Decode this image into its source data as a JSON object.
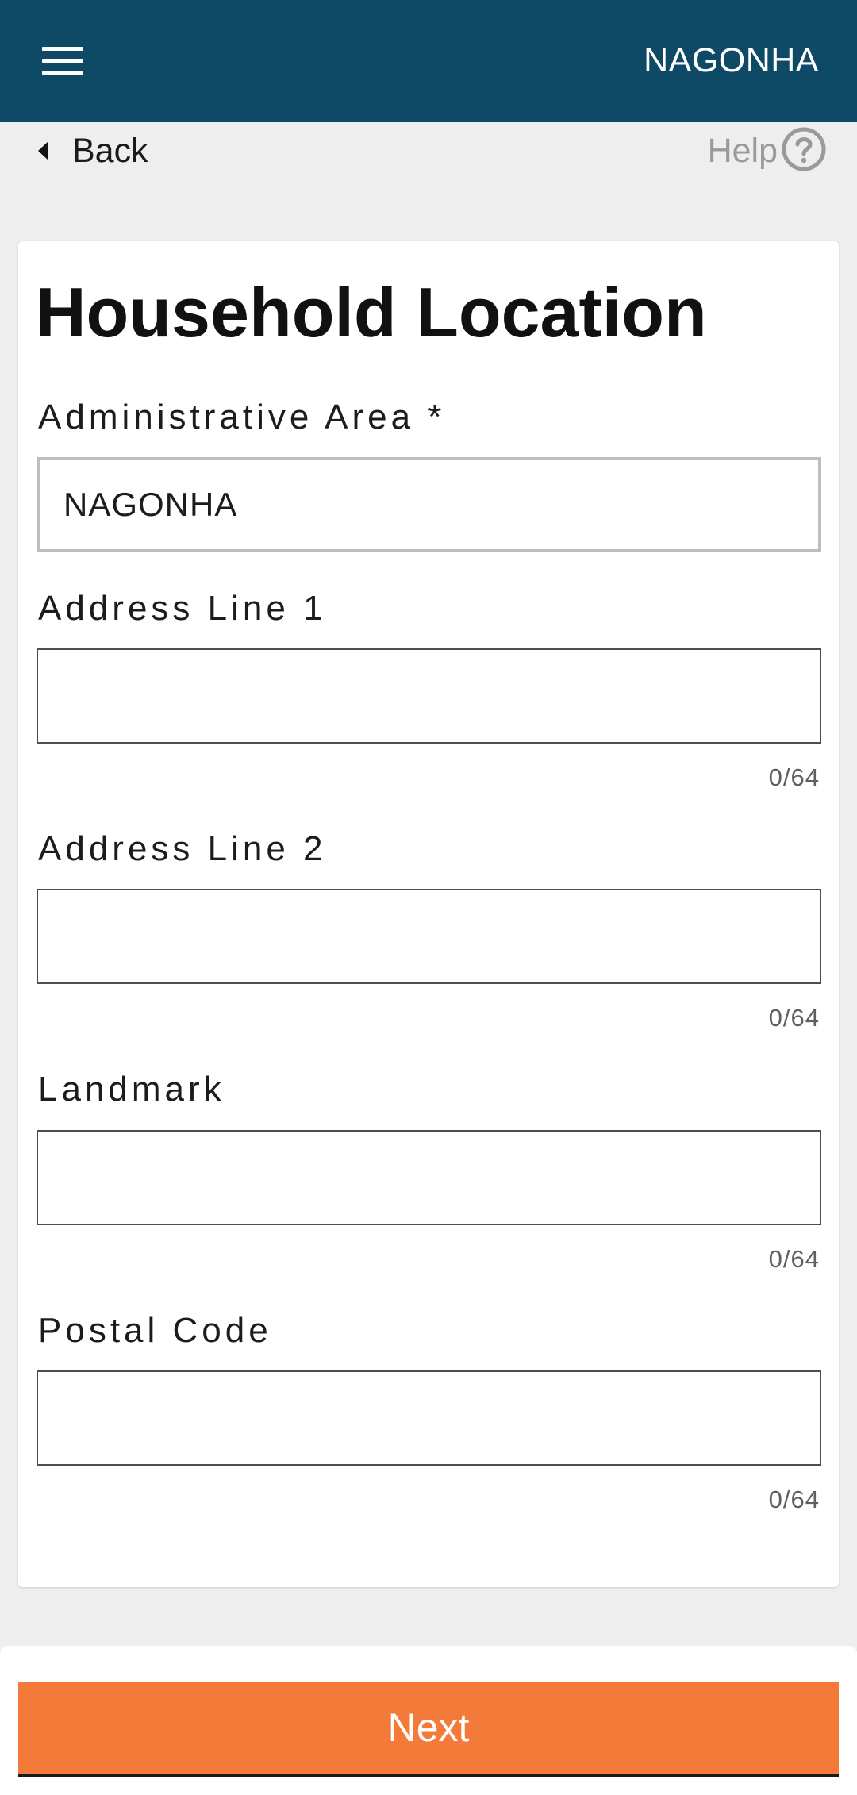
{
  "appbar": {
    "title": "NAGONHA",
    "menu_icon": "hamburger-menu-icon",
    "background_color": "#0e4a66"
  },
  "nav": {
    "back_label": "Back",
    "back_icon": "caret-left-icon",
    "help_label": "Help",
    "help_icon": "question-circle-icon"
  },
  "form": {
    "title": "Household Location",
    "fields": [
      {
        "label": "Administrative Area *",
        "value": "NAGONHA",
        "placeholder": "",
        "required": true,
        "counter": ""
      },
      {
        "label": "Address Line 1",
        "value": "",
        "placeholder": "",
        "counter": "0/64"
      },
      {
        "label": "Address Line 2",
        "value": "",
        "placeholder": "",
        "counter": "0/64"
      },
      {
        "label": "Landmark",
        "value": "",
        "placeholder": "",
        "counter": "0/64"
      },
      {
        "label": "Postal Code",
        "value": "",
        "placeholder": "",
        "counter": "0/64"
      }
    ]
  },
  "footer": {
    "next_label": "Next",
    "accent_color": "#f47a3a"
  }
}
